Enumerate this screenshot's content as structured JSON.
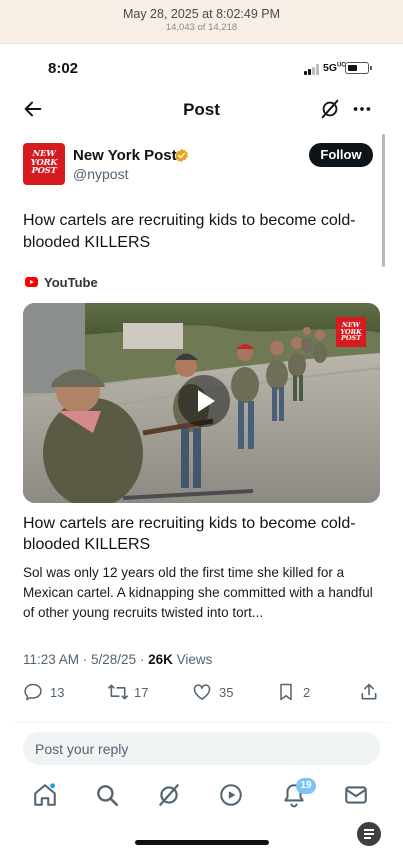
{
  "photos_header": {
    "date": "May 28, 2025 at 8:02:49 PM",
    "count": "14,043 of 14,218"
  },
  "status_bar": {
    "time": "8:02",
    "network": "5G",
    "network_superscript": "UC"
  },
  "nav": {
    "title": "Post",
    "back_icon": "arrow-left-icon",
    "grok_icon": "grok-icon",
    "more_icon": "more-horizontal-icon"
  },
  "author": {
    "avatar_text": "NEW YORK POST",
    "name": "New York Post",
    "handle": "@nypost",
    "verified_color": "#e8a317",
    "follow_label": "Follow"
  },
  "tweet": {
    "text": "How cartels are recruiting kids to become cold-blooded KILLERS"
  },
  "card": {
    "source": "YouTube",
    "badge_text": "NEW YORK POST",
    "title": "How cartels are recruiting kids to become cold-blooded KILLERS",
    "description": "Sol was only 12 years old the first time she killed for a Mexican cartel. A kidnapping she committed with a handful of other young recruits twisted into tort..."
  },
  "meta": {
    "time_date": "11:23 AM · 5/28/25 · ",
    "views_count": "26K",
    "views_label": " Views"
  },
  "actions": {
    "replies": "13",
    "reposts": "17",
    "likes": "35",
    "bookmarks": "2"
  },
  "reply": {
    "placeholder": "Post your reply"
  },
  "tab_bar": {
    "notifications_badge": "19",
    "icons": [
      "home-icon",
      "search-icon",
      "grok-icon",
      "video-icon",
      "notifications-icon",
      "messages-icon"
    ]
  },
  "colors": {
    "brand_red": "#d71920",
    "text_primary": "#0f1419",
    "text_secondary": "#536471",
    "badge_blue": "#7cc4f5"
  }
}
